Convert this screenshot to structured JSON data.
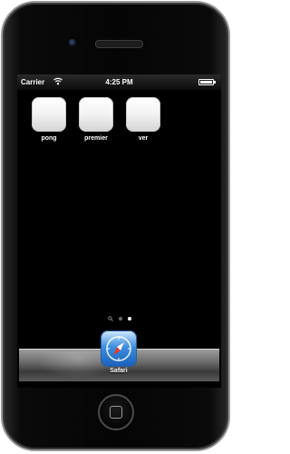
{
  "status_bar": {
    "carrier": "Carrier",
    "time": "4:25 PM",
    "wifi_icon": "wifi-icon",
    "battery_icon": "battery-icon",
    "battery_level": 1.0
  },
  "home_screen": {
    "apps": [
      {
        "label": "pong",
        "icon": "blank-app-icon"
      },
      {
        "label": "premier",
        "icon": "blank-app-icon"
      },
      {
        "label": "ver",
        "icon": "blank-app-icon"
      }
    ],
    "page_indicator": {
      "search_icon": "search-icon",
      "pages": 2,
      "current_page": 2
    }
  },
  "dock": {
    "apps": [
      {
        "label": "Safari",
        "icon": "safari-compass-icon"
      }
    ]
  },
  "device": {
    "home_button_icon": "home-button-icon"
  }
}
